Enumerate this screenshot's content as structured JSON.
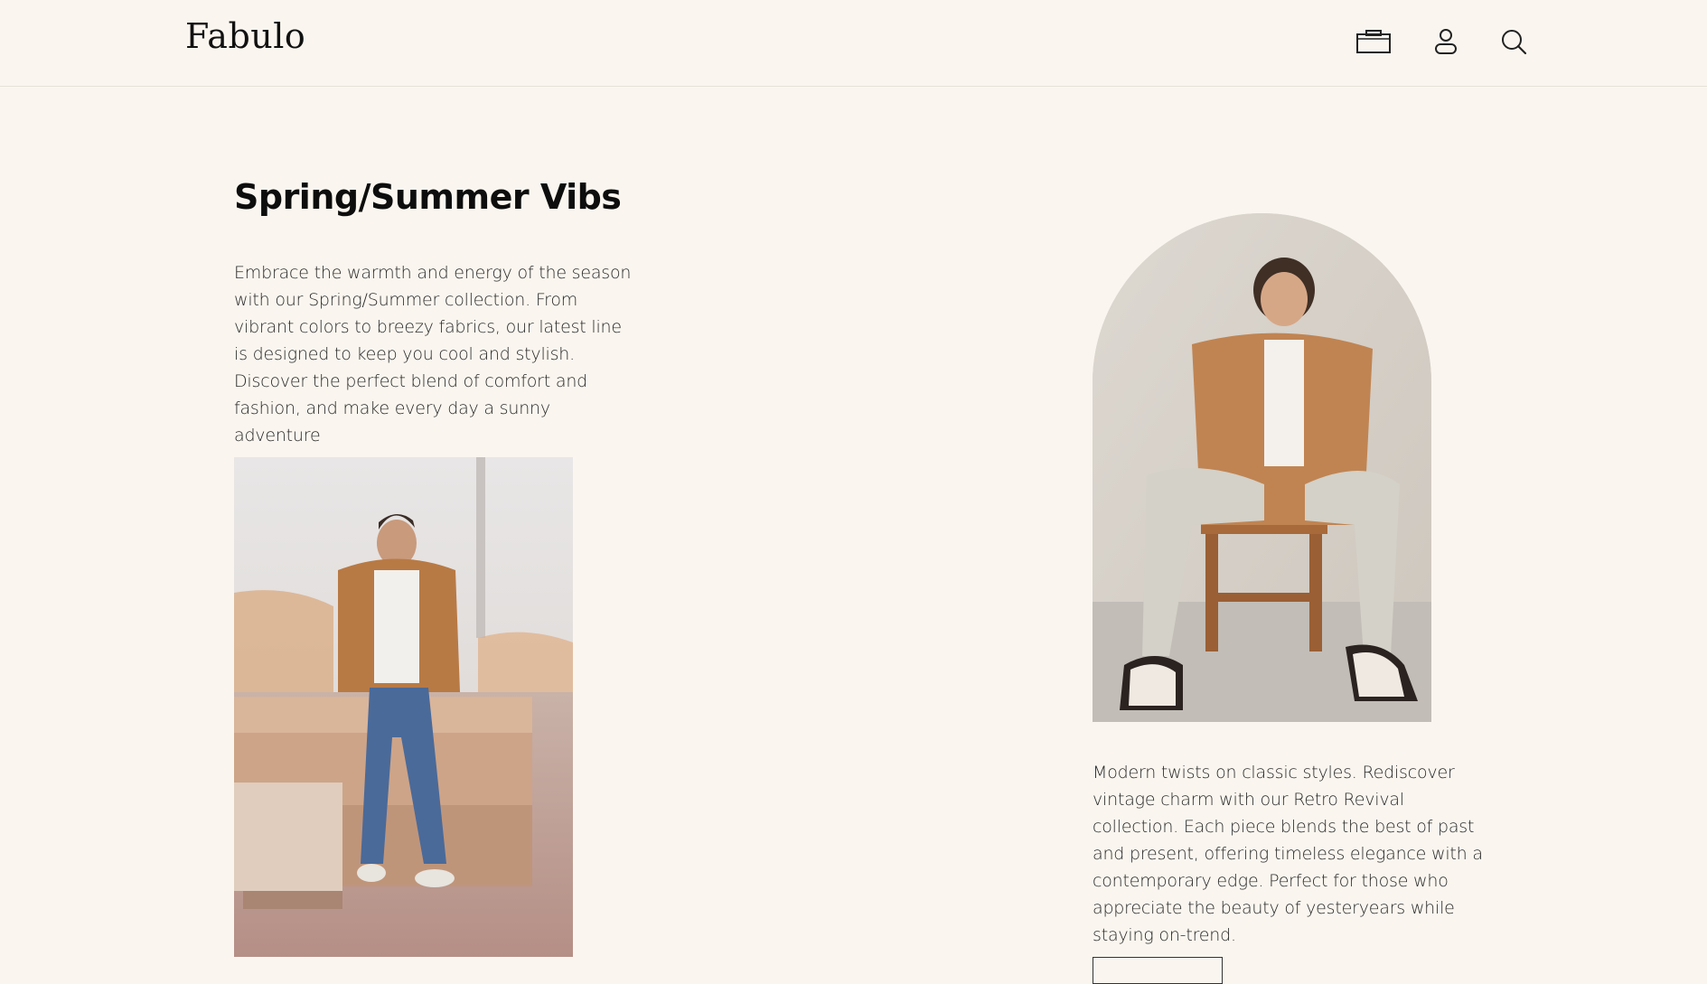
{
  "header": {
    "logo": "Fabulo",
    "icons": [
      "shopping-bag-icon",
      "account-icon",
      "search-icon"
    ]
  },
  "sections": {
    "spring_summer": {
      "title": "Spring/Summer Vibs",
      "description": "Embrace the warmth and energy of the season with our Spring/Summer collection. From vibrant colors to breezy fabrics, our latest line is designed to keep you cool and stylish. Discover the perfect blend of comfort and fashion, and make every day a sunny adventure"
    },
    "retro_revival": {
      "description": "Modern twists on classic styles. Rediscover vintage charm with our Retro Revival collection. Each piece blends the best of past and present, offering timeless elegance with a contemporary edge. Perfect for those who appreciate the beauty of yesteryears while staying on-trend."
    }
  },
  "colors": {
    "background": "#faf6ef",
    "text": "#1a1a1a",
    "jacket": "#b87a45",
    "denim": "#4a6a99"
  }
}
